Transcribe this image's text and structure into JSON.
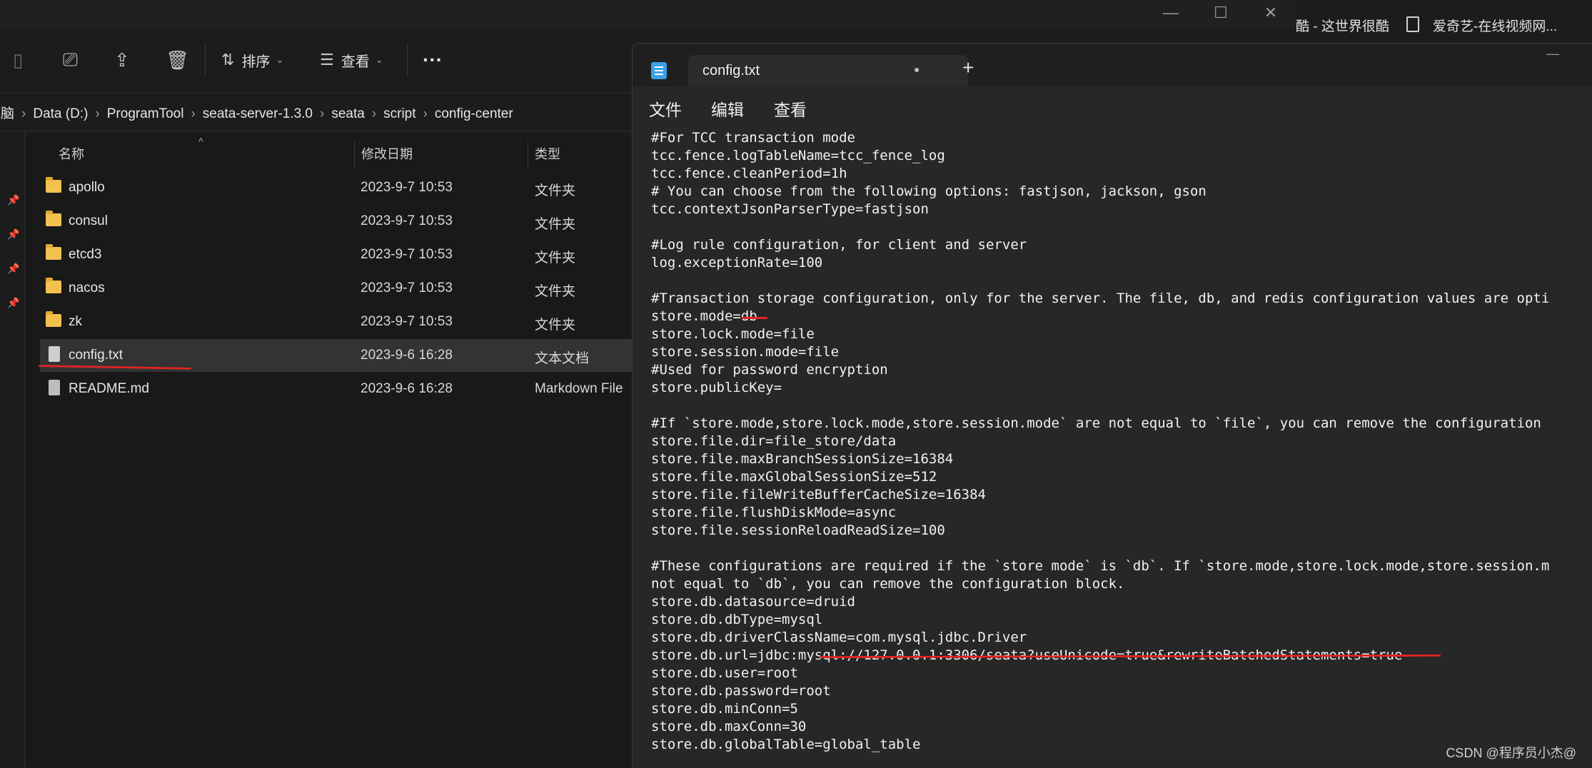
{
  "window_controls": {
    "minimize": "—",
    "maximize": "☐",
    "close": "✕"
  },
  "browser_tabs": [
    {
      "label": "酷 - 这世界很酷"
    },
    {
      "label": "爱奇艺-在线视频网..."
    }
  ],
  "explorer": {
    "toolbar": {
      "sort_label": "排序",
      "view_label": "查看",
      "more_label": "···"
    },
    "breadcrumb": [
      "电脑",
      "Data (D:)",
      "ProgramTool",
      "seata-server-1.3.0",
      "seata",
      "script",
      "config-center"
    ],
    "columns": {
      "name": "名称",
      "modified": "修改日期",
      "type": "类型"
    },
    "files": [
      {
        "name": "apollo",
        "date": "2023-9-7 10:53",
        "type": "文件夹",
        "kind": "folder"
      },
      {
        "name": "consul",
        "date": "2023-9-7 10:53",
        "type": "文件夹",
        "kind": "folder"
      },
      {
        "name": "etcd3",
        "date": "2023-9-7 10:53",
        "type": "文件夹",
        "kind": "folder"
      },
      {
        "name": "nacos",
        "date": "2023-9-7 10:53",
        "type": "文件夹",
        "kind": "folder"
      },
      {
        "name": "zk",
        "date": "2023-9-7 10:53",
        "type": "文件夹",
        "kind": "folder"
      },
      {
        "name": "config.txt",
        "date": "2023-9-6 16:28",
        "type": "文本文档",
        "kind": "text",
        "selected": true
      },
      {
        "name": "README.md",
        "date": "2023-9-6 16:28",
        "type": "Markdown File",
        "kind": "markdown"
      }
    ]
  },
  "notepad": {
    "tab_title": "config.txt",
    "tab_modified_dot": "●",
    "new_tab": "+",
    "minimize": "—",
    "menu": {
      "file": "文件",
      "edit": "编辑",
      "view": "查看"
    },
    "lines": [
      "#For TCC transaction mode",
      "tcc.fence.logTableName=tcc_fence_log",
      "tcc.fence.cleanPeriod=1h",
      "# You can choose from the following options: fastjson, jackson, gson",
      "tcc.contextJsonParserType=fastjson",
      "",
      "#Log rule configuration, for client and server",
      "log.exceptionRate=100",
      "",
      "#Transaction storage configuration, only for the server. The file, db, and redis configuration values are opti",
      "store.mode=db",
      "store.lock.mode=file",
      "store.session.mode=file",
      "#Used for password encryption",
      "store.publicKey=",
      "",
      "#If `store.mode,store.lock.mode,store.session.mode` are not equal to `file`, you can remove the configuration",
      "store.file.dir=file_store/data",
      "store.file.maxBranchSessionSize=16384",
      "store.file.maxGlobalSessionSize=512",
      "store.file.fileWriteBufferCacheSize=16384",
      "store.file.flushDiskMode=async",
      "store.file.sessionReloadReadSize=100",
      "",
      "#These configurations are required if the `store mode` is `db`. If `store.mode,store.lock.mode,store.session.m",
      "not equal to `db`, you can remove the configuration block.",
      "store.db.datasource=druid",
      "store.db.dbType=mysql",
      "store.db.driverClassName=com.mysql.jdbc.Driver",
      "store.db.url=jdbc:mysql://127.0.0.1:3306/seata?useUnicode=true&rewriteBatchedStatements=true",
      "store.db.user=root",
      "store.db.password=root",
      "store.db.minConn=5",
      "store.db.maxConn=30",
      "store.db.globalTable=global_table"
    ]
  },
  "watermark": "CSDN @程序员小杰@",
  "colors": {
    "annotation_red": "#e02424",
    "folder": "#f2c14e",
    "notepad_icon": "#3aa0e8"
  }
}
